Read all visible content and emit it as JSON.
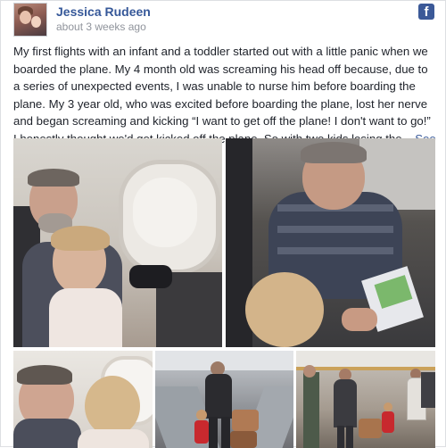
{
  "post": {
    "author": "Jessica Rudeen",
    "time": "about 3 weeks ago",
    "text": "My first flights with an infant and a toddler started out with a little panic when we boarded the plane. My 4 month old was screaming his head off because, due to a series of unexpected events, I was unable to nurse him before boarding the plane. My 3 year old, who was excited before boarding the plane, lost her nerve and began screaming and kicking “I want to get off the plane! I don't want to go!” I honestly thought we'd get kicked off the plane. So with two kids losing the...",
    "see_more": "See More"
  },
  "icons": {
    "facebook": "facebook-icon",
    "facebook_glyph": "f"
  },
  "colors": {
    "link": "#365899",
    "facebook_blue": "#3b5998",
    "meta_gray": "#90949c"
  }
}
